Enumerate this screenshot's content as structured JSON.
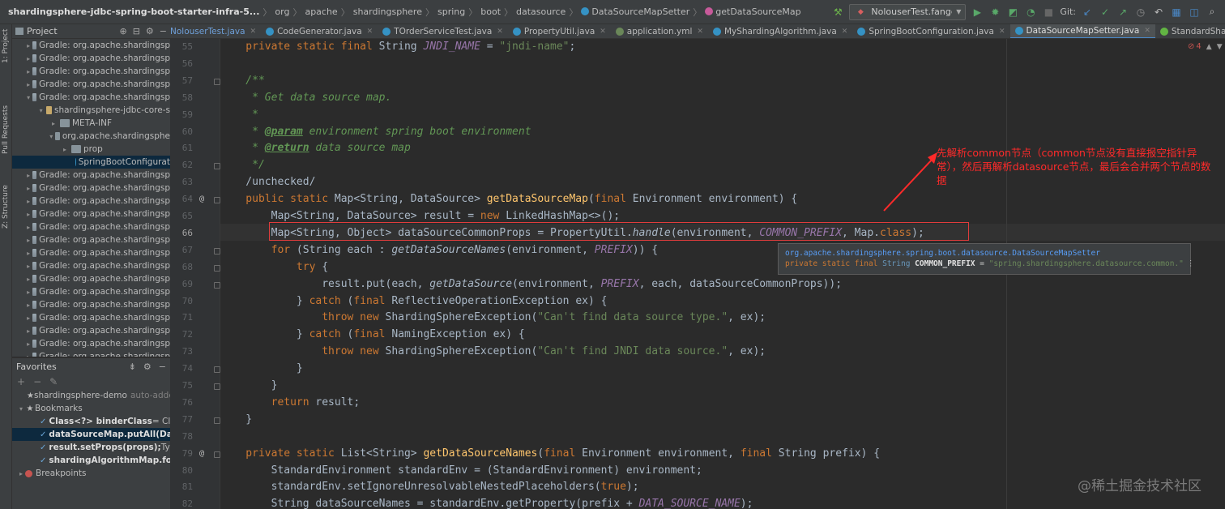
{
  "breadcrumb": {
    "project": "shardingsphere-jdbc-spring-boot-starter-infra-5...",
    "items": [
      "org",
      "apache",
      "shardingsphere",
      "spring",
      "boot",
      "datasource"
    ],
    "class_name": "DataSourceMapSetter",
    "method_name": "getDataSourceMap"
  },
  "toolbar": {
    "run_config": "NolouserTest.fangdai",
    "git_label": "Git:"
  },
  "left_strip": [
    "1: Project",
    "Pull Requests",
    "Z: Structure"
  ],
  "project_panel": {
    "title": "Project",
    "rows": [
      {
        "text": "Gradle: org.apache.shardingsp",
        "indent": 0,
        "arrow": "▸",
        "icon": "lib"
      },
      {
        "text": "Gradle: org.apache.shardingsp",
        "indent": 0,
        "arrow": "▸",
        "icon": "lib"
      },
      {
        "text": "Gradle: org.apache.shardingsp",
        "indent": 0,
        "arrow": "▸",
        "icon": "lib"
      },
      {
        "text": "Gradle: org.apache.shardingsp",
        "indent": 0,
        "arrow": "▸",
        "icon": "lib"
      },
      {
        "text": "Gradle: org.apache.shardingsp",
        "indent": 0,
        "arrow": "▾",
        "icon": "lib"
      },
      {
        "text": "shardingsphere-jdbc-core-s",
        "indent": 1,
        "arrow": "▾",
        "icon": "jar"
      },
      {
        "text": "META-INF",
        "indent": 2,
        "arrow": "▸",
        "icon": "folder"
      },
      {
        "text": "org.apache.shardingsphe",
        "indent": 2,
        "arrow": "▾",
        "icon": "folder"
      },
      {
        "text": "prop",
        "indent": 3,
        "arrow": "▸",
        "icon": "folder"
      },
      {
        "text": "SpringBootConfigurat",
        "indent": 4,
        "arrow": "",
        "icon": "class",
        "selected": true
      },
      {
        "text": "Gradle: org.apache.shardingsp",
        "indent": 0,
        "arrow": "▸",
        "icon": "lib"
      },
      {
        "text": "Gradle: org.apache.shardingsp",
        "indent": 0,
        "arrow": "▸",
        "icon": "lib"
      },
      {
        "text": "Gradle: org.apache.shardingsp",
        "indent": 0,
        "arrow": "▸",
        "icon": "lib"
      },
      {
        "text": "Gradle: org.apache.shardingsp",
        "indent": 0,
        "arrow": "▸",
        "icon": "lib"
      },
      {
        "text": "Gradle: org.apache.shardingsp",
        "indent": 0,
        "arrow": "▸",
        "icon": "lib"
      },
      {
        "text": "Gradle: org.apache.shardingsp",
        "indent": 0,
        "arrow": "▸",
        "icon": "lib"
      },
      {
        "text": "Gradle: org.apache.shardingsp",
        "indent": 0,
        "arrow": "▸",
        "icon": "lib"
      },
      {
        "text": "Gradle: org.apache.shardingsp",
        "indent": 0,
        "arrow": "▸",
        "icon": "lib"
      },
      {
        "text": "Gradle: org.apache.shardingsp",
        "indent": 0,
        "arrow": "▸",
        "icon": "lib"
      },
      {
        "text": "Gradle: org.apache.shardingsp",
        "indent": 0,
        "arrow": "▸",
        "icon": "lib"
      },
      {
        "text": "Gradle: org.apache.shardingsp",
        "indent": 0,
        "arrow": "▸",
        "icon": "lib"
      },
      {
        "text": "Gradle: org.apache.shardingsp",
        "indent": 0,
        "arrow": "▸",
        "icon": "lib"
      },
      {
        "text": "Gradle: org.apache.shardingsp",
        "indent": 0,
        "arrow": "▸",
        "icon": "lib"
      },
      {
        "text": "Gradle: org.apache.shardingsp",
        "indent": 0,
        "arrow": "▸",
        "icon": "lib"
      },
      {
        "text": "Gradle: org.apache.shardingsp",
        "indent": 0,
        "arrow": "▸",
        "icon": "lib"
      }
    ]
  },
  "favorites_panel": {
    "title": "Favorites",
    "rows": [
      {
        "type": "group",
        "text": "shardingsphere-demo",
        "dim": "auto-added"
      },
      {
        "type": "group2",
        "text": "Bookmarks"
      },
      {
        "type": "bm",
        "bold": "Class<?> binderClass",
        "rest": " = Clas",
        "selected": false
      },
      {
        "type": "bm",
        "bold": "dataSourceMap.putAll(Data",
        "rest": "",
        "selected": true
      },
      {
        "type": "bm",
        "bold": "result.setProps(props);",
        "rest": " Type",
        "selected": false
      },
      {
        "type": "bm",
        "bold": "shardingAlgorithmMap.for",
        "rest": "",
        "selected": false
      },
      {
        "type": "bp",
        "text": "Breakpoints"
      }
    ]
  },
  "tabs": [
    {
      "label": "NolouserTest.java",
      "color": "#c7a96a",
      "blue": true,
      "active": false
    },
    {
      "label": "CodeGenerator.java",
      "color": "#3592c4",
      "blue": false,
      "active": false
    },
    {
      "label": "TOrderServiceTest.java",
      "color": "#3592c4",
      "blue": false,
      "active": false
    },
    {
      "label": "PropertyUtil.java",
      "color": "#3592c4",
      "blue": false,
      "active": false
    },
    {
      "label": "application.yml",
      "color": "#6a8759",
      "blue": false,
      "active": false
    },
    {
      "label": "MyShardingAlgorithm.java",
      "color": "#3592c4",
      "blue": false,
      "active": false
    },
    {
      "label": "SpringBootConfiguration.java",
      "color": "#3592c4",
      "blue": false,
      "active": false
    },
    {
      "label": "DataSourceMapSetter.java",
      "color": "#3592c4",
      "blue": false,
      "active": true
    },
    {
      "label": "StandardShardingAlgorithm.java",
      "color": "#62b543",
      "blue": false,
      "active": false
    }
  ],
  "editor": {
    "line_numbers": [
      "55",
      "56",
      "57",
      "58",
      "59",
      "60",
      "61",
      "62",
      "63",
      "64",
      "65",
      "66",
      "67",
      "68",
      "69",
      "70",
      "71",
      "72",
      "73",
      "74",
      "75",
      "76",
      "77",
      "78",
      "79",
      "80",
      "81",
      "82"
    ],
    "current_line": "66",
    "error_count": "4",
    "lines": [
      [
        [
          "kw",
          "    private static final "
        ],
        [
          "",
          "String "
        ],
        [
          "cst",
          "JNDI_NAME"
        ],
        [
          "",
          " = "
        ],
        [
          "str",
          "\"jndi-name\""
        ],
        [
          "",
          ";"
        ]
      ],
      [],
      [
        [
          "cmt",
          "    /**"
        ]
      ],
      [
        [
          "cmt",
          "     * Get data source map."
        ]
      ],
      [
        [
          "cmt",
          "     *"
        ]
      ],
      [
        [
          "cmt",
          "     * "
        ],
        [
          "tag",
          "@param"
        ],
        [
          "cmt",
          " environment spring boot environment"
        ]
      ],
      [
        [
          "cmt",
          "     * "
        ],
        [
          "tag",
          "@return"
        ],
        [
          "cmt",
          " data source map"
        ]
      ],
      [
        [
          "cmt",
          "     */"
        ]
      ],
      [
        [
          "",
          "    /unchecked/"
        ]
      ],
      [
        [
          "kw",
          "    public static "
        ],
        [
          "",
          "Map<String, DataSource> "
        ],
        [
          "fn",
          "getDataSourceMap"
        ],
        [
          "",
          "("
        ],
        [
          "kw",
          "final "
        ],
        [
          "",
          "Environment environment) {"
        ]
      ],
      [
        [
          "",
          "        Map<String, DataSource> result = "
        ],
        [
          "kw",
          "new "
        ],
        [
          "",
          "LinkedHashMap<>();"
        ]
      ],
      [
        [
          "",
          "        Map<String, Object> dataSourceCommonProps = PropertyUtil."
        ],
        [
          "st",
          "handle"
        ],
        [
          "",
          "(environment, "
        ],
        [
          "cst",
          "COMMON_PREFIX"
        ],
        [
          "",
          ", Map."
        ],
        [
          "kw",
          "class"
        ],
        [
          "",
          ");"
        ]
      ],
      [
        [
          "kw",
          "        for "
        ],
        [
          "",
          "(String each : "
        ],
        [
          "st",
          "getDataSourceNames"
        ],
        [
          "",
          "(environment, "
        ],
        [
          "cst",
          "PREFIX"
        ],
        [
          "",
          ")) {"
        ]
      ],
      [
        [
          "kw",
          "            try "
        ],
        [
          "",
          "{"
        ]
      ],
      [
        [
          "",
          "                result.put(each, "
        ],
        [
          "st",
          "getDataSource"
        ],
        [
          "",
          "(environment, "
        ],
        [
          "cst",
          "PREFIX"
        ],
        [
          "",
          ", each, dataSourceCommonProps));"
        ]
      ],
      [
        [
          "",
          "            } "
        ],
        [
          "kw",
          "catch "
        ],
        [
          "",
          "("
        ],
        [
          "kw",
          "final "
        ],
        [
          "",
          "ReflectiveOperationException ex) {"
        ]
      ],
      [
        [
          "kw",
          "                throw new "
        ],
        [
          "",
          "ShardingSphereException("
        ],
        [
          "str",
          "\"Can't find data source type.\""
        ],
        [
          "",
          ", ex);"
        ]
      ],
      [
        [
          "",
          "            } "
        ],
        [
          "kw",
          "catch "
        ],
        [
          "",
          "("
        ],
        [
          "kw",
          "final "
        ],
        [
          "",
          "NamingException ex) {"
        ]
      ],
      [
        [
          "kw",
          "                throw new "
        ],
        [
          "",
          "ShardingSphereException("
        ],
        [
          "str",
          "\"Can't find JNDI data source.\""
        ],
        [
          "",
          ", ex);"
        ]
      ],
      [
        [
          "",
          "            }"
        ]
      ],
      [
        [
          "",
          "        }"
        ]
      ],
      [
        [
          "kw",
          "        return "
        ],
        [
          "",
          "result;"
        ]
      ],
      [
        [
          "",
          "    }"
        ]
      ],
      [],
      [
        [
          "kw",
          "    private static "
        ],
        [
          "",
          "List<String> "
        ],
        [
          "fn",
          "getDataSourceNames"
        ],
        [
          "",
          "("
        ],
        [
          "kw",
          "final "
        ],
        [
          "",
          "Environment environment, "
        ],
        [
          "kw",
          "final "
        ],
        [
          "",
          "String prefix) {"
        ]
      ],
      [
        [
          "",
          "        StandardEnvironment standardEnv = (StandardEnvironment) environment;"
        ]
      ],
      [
        [
          "",
          "        standardEnv.setIgnoreUnresolvableNestedPlaceholders("
        ],
        [
          "kw",
          "true"
        ],
        [
          "",
          ");"
        ]
      ],
      [
        [
          "",
          "        String dataSourceNames = standardEnv.getProperty(prefix + "
        ],
        [
          "cst",
          "DATA_SOURCE_NAME"
        ],
        [
          "",
          ");"
        ]
      ]
    ]
  },
  "tooltip": {
    "line1": "org.apache.shardingsphere.spring.boot.datasource.DataSourceMapSetter",
    "line2_kw": "private static final ",
    "line2_type": "String",
    "line2_name": " COMMON_PREFIX",
    "line2_eq": " = ",
    "line2_val": "\"spring.shardingsphere.datasource.common.\""
  },
  "annotation": {
    "text": "先解析common节点（common节点没有直接报空指针异常），然后再解析datasource节点，最后会合并两个节点的数据",
    "color": "#ff2a2a"
  },
  "watermark": "@稀土掘金技术社区"
}
